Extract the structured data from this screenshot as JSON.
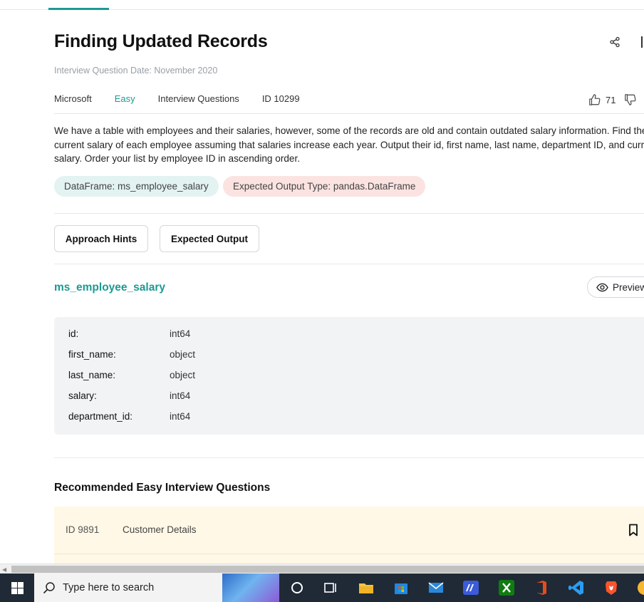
{
  "page": {
    "title": "Finding Updated Records",
    "date_line": "Interview Question Date: November 2020"
  },
  "meta": {
    "company": "Microsoft",
    "difficulty": "Easy",
    "category": "Interview Questions",
    "id": "ID 10299",
    "upvotes": "71"
  },
  "description": "We have a table with employees and their salaries, however, some of the records are old and contain outdated salary information. Find the current salary of each employee assuming that salaries increase each year. Output their id, first name, last name, department ID, and current salary. Order your list by employee ID in ascending order.",
  "tags": {
    "dataframe": "DataFrame: ms_employee_salary",
    "output_type": "Expected Output Type: pandas.DataFrame"
  },
  "buttons": {
    "hints": "Approach Hints",
    "expected": "Expected Output",
    "preview": "Preview"
  },
  "table": {
    "name": "ms_employee_salary",
    "columns": [
      {
        "name": "id:",
        "type": "int64"
      },
      {
        "name": "first_name:",
        "type": "object"
      },
      {
        "name": "last_name:",
        "type": "object"
      },
      {
        "name": "salary:",
        "type": "int64"
      },
      {
        "name": "department_id:",
        "type": "int64"
      }
    ]
  },
  "recommended": {
    "heading": "Recommended Easy Interview Questions",
    "items": [
      {
        "id": "ID 9891",
        "name": "Customer Details"
      }
    ]
  },
  "taskbar": {
    "search_placeholder": "Type here to search"
  },
  "colors": {
    "accent": "#1b9a93",
    "df_pill": "#e2f3f1",
    "output_pill": "#fbe3e1",
    "card": "#fff8e6"
  }
}
